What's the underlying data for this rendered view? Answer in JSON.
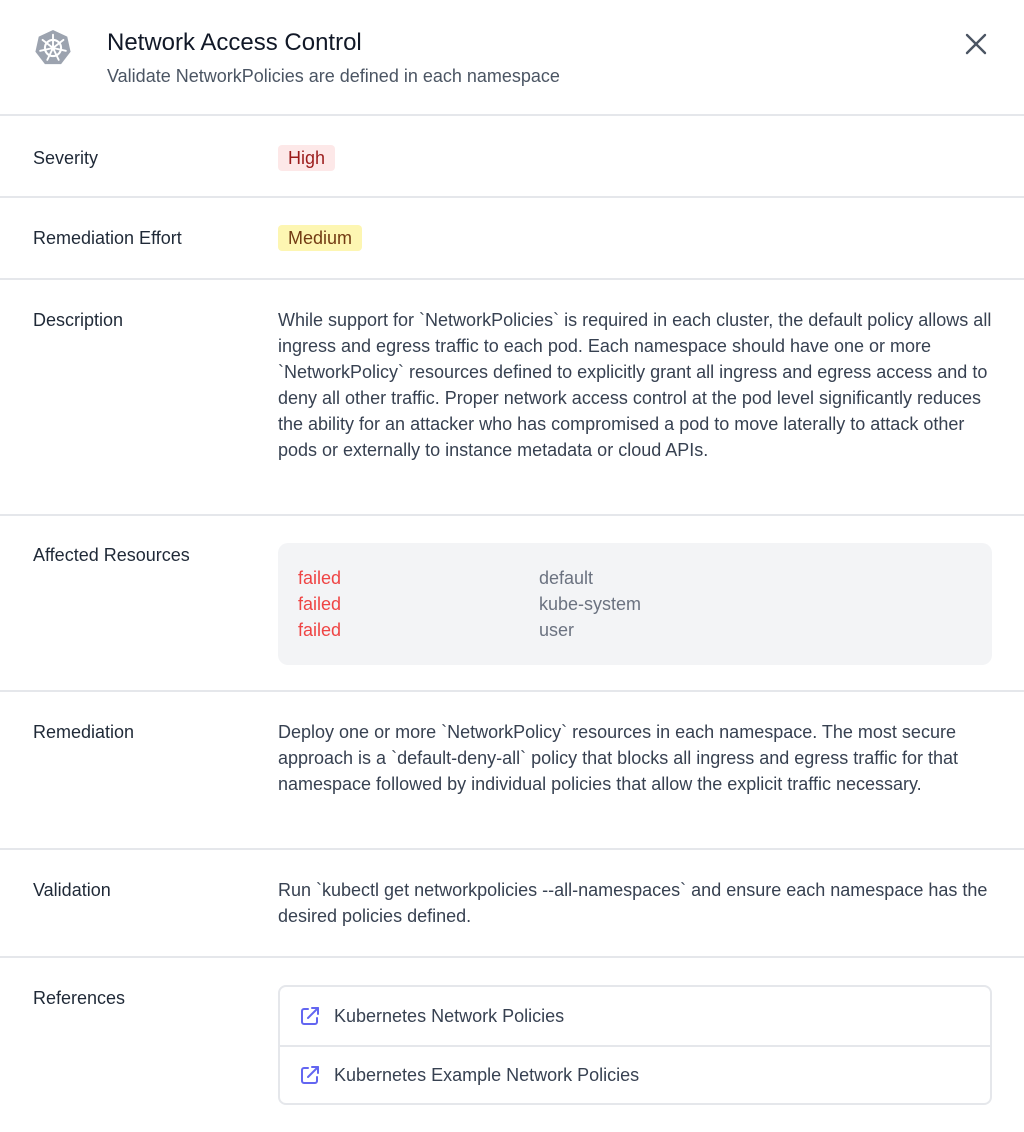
{
  "header": {
    "title": "Network Access Control",
    "subtitle": "Validate NetworkPolicies are defined in each namespace",
    "logo_icon": "kubernetes-helm-icon",
    "close_icon": "close-icon"
  },
  "severity": {
    "label": "Severity",
    "value": "High",
    "badge_bg": "#fde8e8",
    "badge_color": "#9b1c1c"
  },
  "remediation_effort": {
    "label": "Remediation Effort",
    "value": "Medium",
    "badge_bg": "#fdf6b2",
    "badge_color": "#723b13"
  },
  "description": {
    "label": "Description",
    "text": "While support for `NetworkPolicies` is required in each cluster, the default policy allows all ingress and egress traffic to each pod. Each namespace should have one or more `NetworkPolicy` resources defined to explicitly grant all ingress and egress access and to deny all other traffic. Proper network access control at the pod level significantly reduces the ability for an attacker who has compromised a pod to move laterally to attack other pods or externally to instance metadata or cloud APIs."
  },
  "affected_resources": {
    "label": "Affected Resources",
    "items": [
      {
        "status": "failed",
        "name": "default"
      },
      {
        "status": "failed",
        "name": "kube-system"
      },
      {
        "status": "failed",
        "name": "user"
      }
    ],
    "status_color": "#ef4444"
  },
  "remediation": {
    "label": "Remediation",
    "text": "Deploy one or more `NetworkPolicy` resources in each namespace. The most secure approach is a `default-deny-all` policy that blocks all ingress and egress traffic for that namespace followed by individual policies that allow the explicit traffic necessary."
  },
  "validation": {
    "label": "Validation",
    "text": "Run `kubectl get networkpolicies --all-namespaces` and ensure each namespace has the desired policies defined."
  },
  "references": {
    "label": "References",
    "items": [
      {
        "label": "Kubernetes Network Policies",
        "icon": "external-link-icon"
      },
      {
        "label": "Kubernetes Example Network Policies",
        "icon": "external-link-icon"
      }
    ],
    "icon_color": "#6366f1"
  }
}
